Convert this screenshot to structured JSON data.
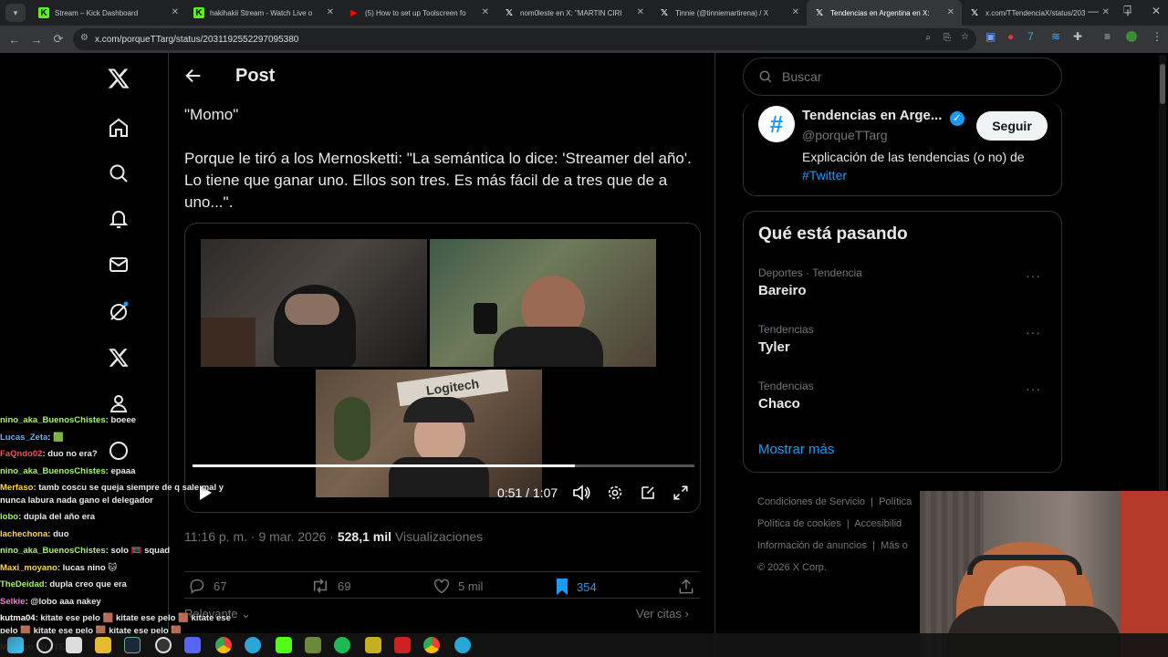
{
  "browser": {
    "tabs": [
      {
        "label": "Stream – Kick Dashboard",
        "fav": "kick-icon",
        "color": "#53fc18"
      },
      {
        "label": "hakihakii Stream - Watch Live o",
        "fav": "kick-icon",
        "color": "#53fc18"
      },
      {
        "label": "(5) How to set up Toolscreen fo",
        "fav": "youtube-icon",
        "color": "#ff0000"
      },
      {
        "label": "nom0leste en X: \"MARTIN CIRI",
        "fav": "x-icon",
        "color": "#ffffff"
      },
      {
        "label": "Tinnie (@tinniemartirena) / X",
        "fav": "x-icon",
        "color": "#ffffff"
      },
      {
        "label": "Tendencias en Argentina en X:",
        "fav": "x-icon",
        "color": "#ffffff",
        "active": true
      },
      {
        "label": "x.com/TTendenciaX/status/203",
        "fav": "x-icon",
        "color": "#ffffff"
      }
    ],
    "url": "x.com/porqueTTarg/status/2031192552297095380"
  },
  "nav": {
    "header_title": "Post"
  },
  "post": {
    "text_line1": "\"Momo\"",
    "text_line2": "Porque le tiró a los Mernosketti: \"La semántica lo dice: 'Streamer del año'. Lo tiene que ganar uno. Ellos son tres. Es más fácil de a tres que de a uno...\".",
    "video": {
      "time": "0:51 / 1:07",
      "progress": 0.762
    },
    "time": "11:16 p. m.",
    "date": "9 mar. 2026",
    "views": "528,1 mil",
    "views_label": "Visualizaciones",
    "replies": "67",
    "reposts": "69",
    "likes": "5 mil",
    "bookmarks": "354",
    "relevante": "Relevante",
    "ver_citas": "Ver citas"
  },
  "sidebar": {
    "search_placeholder": "Buscar",
    "profile": {
      "name": "Tendencias en Arge...",
      "handle": "@porqueTTarg",
      "bio": "Explicación de las tendencias (o no) de",
      "bio_link": "#Twitter",
      "follow": "Seguir"
    },
    "happening_title": "Qué está pasando",
    "trends": [
      {
        "cat": "Deportes · Tendencia",
        "name": "Bareiro"
      },
      {
        "cat": "Tendencias",
        "name": "Tyler"
      },
      {
        "cat": "Tendencias",
        "name": "Chaco"
      }
    ],
    "show_more": "Mostrar más",
    "footer": {
      "terms": "Condiciones de Servicio",
      "policy": "Política",
      "cookies": "Política de cookies",
      "access": "Accesibilid",
      "ads": "Información de anuncios",
      "more": "Más o",
      "copy": "© 2026 X Corp."
    }
  },
  "chat": [
    {
      "user": "nino_aka_BuenosChistes",
      "color": "#a4f46b",
      "msg": "boeee"
    },
    {
      "user": "Lucas_Zeta",
      "color": "#5ab5ff",
      "msg": "🟩"
    },
    {
      "user": "FaQndo02",
      "color": "#ff4d4d",
      "msg": "duo no era?"
    },
    {
      "user": "nino_aka_BuenosChistes",
      "color": "#a4f46b",
      "msg": "epaaa"
    },
    {
      "user": "Merfaso",
      "color": "#ffd84d",
      "msg": "tamb coscu se queja siempre de q sale mal y nunca labura nada gano el delegador"
    },
    {
      "user": "lobo",
      "color": "#a4f46b",
      "msg": "dupla del año era"
    },
    {
      "user": "lachechona",
      "color": "#ffd84d",
      "msg": "duo"
    },
    {
      "user": "nino_aka_BuenosChistes",
      "color": "#a4f46b",
      "msg": "solo 🥅 squad"
    },
    {
      "user": "Maxi_moyano",
      "color": "#ffd84d",
      "msg": "lucas nino 🐱"
    },
    {
      "user": "TheDeidad",
      "color": "#a4f46b",
      "msg": "dupla creo que era"
    },
    {
      "user": "Selkie",
      "color": "#ff7ad9",
      "msg": "@lobo aaa nakey"
    },
    {
      "user": "kutma04",
      "color": "#ffffff",
      "msg": "kitate ese pelo 🟫 kitate ese pelo 🟫 kitate ese pelo 🟫 kitate ese pelo 🟫 kitate ese pelo 🟫"
    },
    {
      "user": "Merfaso",
      "color": "#ffd84d",
      "msg": "SI, ITERAL"
    }
  ]
}
